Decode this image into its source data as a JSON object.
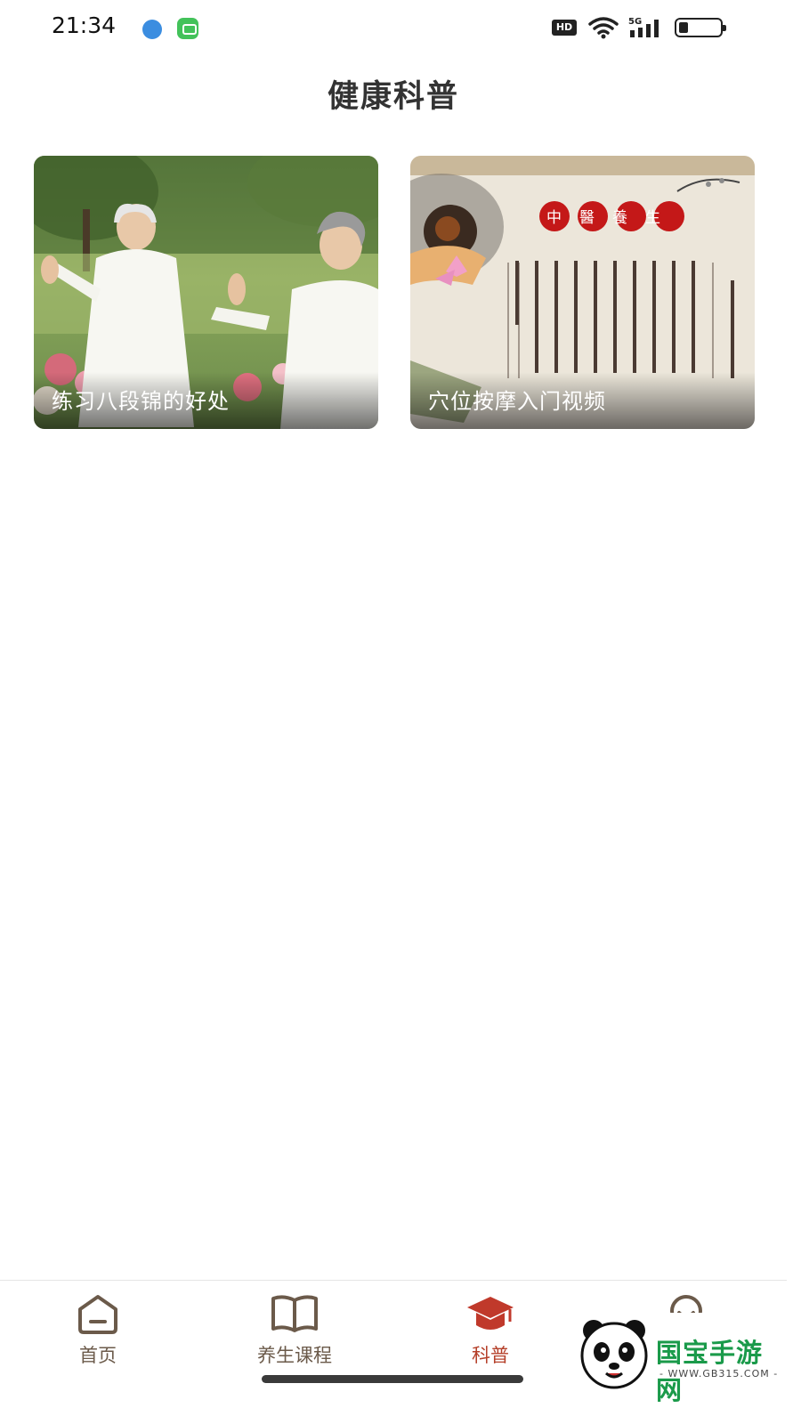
{
  "status_bar": {
    "time": "21:34",
    "hd_label": "HD",
    "network_label": "5G"
  },
  "header": {
    "title": "健康科普"
  },
  "articles": [
    {
      "title": "练习八段锦的好处",
      "image_icon": "photo-elderly-tai-chi"
    },
    {
      "title": "穴位按摩入门视频",
      "image_icon": "photo-tcm-health-scroll",
      "image_text": "中醫養生"
    }
  ],
  "bottom_nav": {
    "items": [
      {
        "label": "首页",
        "icon": "home-icon",
        "active": false
      },
      {
        "label": "养生课程",
        "icon": "book-icon",
        "active": false
      },
      {
        "label": "科普",
        "icon": "graduation-cap-icon",
        "active": true
      },
      {
        "label": "",
        "icon": "user-icon",
        "active": false
      }
    ],
    "active_color": "#b5402a",
    "inactive_color": "#6b5a4a"
  },
  "watermark": {
    "brand": "国宝手游网",
    "url": "- WWW.GB315.COM -"
  }
}
